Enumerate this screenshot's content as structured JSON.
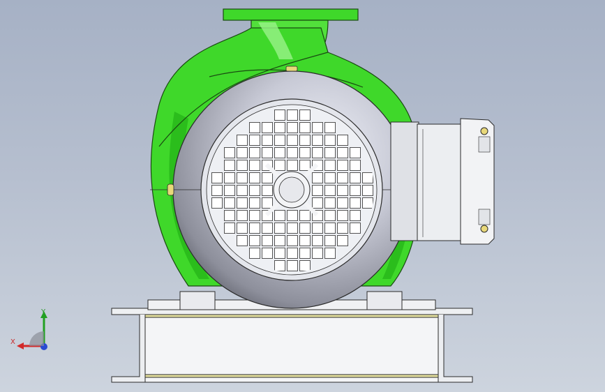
{
  "viewport": {
    "background_top": "#a6b1c5",
    "background_bottom": "#cdd4de"
  },
  "model": {
    "volute_color": "#3fd82a",
    "volute_dark": "#1ea512",
    "motor_color": "#c9cbd7",
    "fan_cover_color": "#eceef2",
    "terminal_box_color": "#eeeff2",
    "bolt_color": "#e8d87a",
    "base_color": "#f1f2f4",
    "outline_color": "#2a2a2a"
  },
  "triad": {
    "x_label": "X",
    "y_label": "Y",
    "x_color": "#d22a2a",
    "y_color": "#22a022",
    "z_color": "#2a4ad2",
    "view_icon": "view-orientation-triad-icon"
  }
}
